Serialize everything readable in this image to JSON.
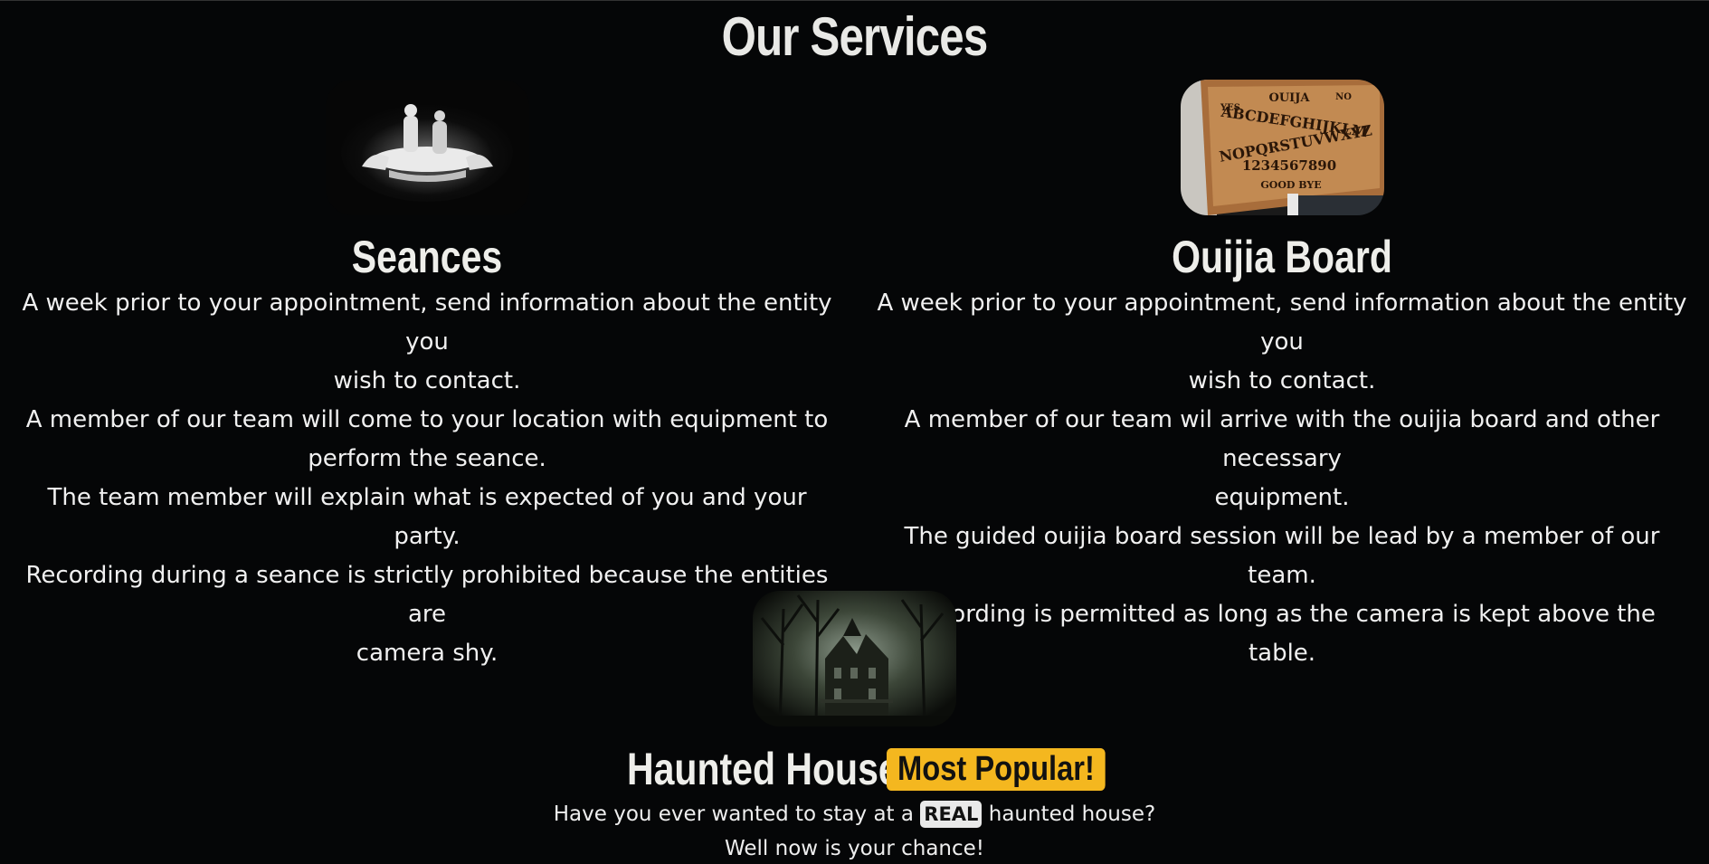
{
  "page": {
    "title": "Our Services"
  },
  "services": [
    {
      "title": "Seances",
      "image_icon": "seance-photo",
      "lines": [
        "A week prior to your appointment, send information about the entity you",
        "wish to contact.",
        "A member of our team will come to your location with equipment to",
        "perform the seance.",
        "The team member will explain what is expected of you and your party.",
        "Recording during a seance is strictly prohibited because the entities are",
        "camera shy."
      ]
    },
    {
      "title": "Ouijia Board",
      "image_icon": "ouija-board-photo",
      "board_text": {
        "yes": "YES",
        "word": "OUIJA",
        "no": "NO",
        "row1": "ABCDEFGHIJKLM",
        "row2": "NOPQRSTUVWXYZ",
        "numbers": "1234567890",
        "bye": "GOOD BYE"
      },
      "lines": [
        "A week prior to your appointment, send information about the entity you",
        "wish to contact.",
        "A member of our team wil arrive with the ouijia board and other necessary",
        "equipment.",
        "The guided ouijia board session will be lead by a member of our team.",
        "Recording is permitted as long as the camera is kept above the table."
      ]
    }
  ],
  "haunted_house": {
    "title": "Haunted House",
    "badge": "Most Popular!",
    "image_icon": "haunted-house-photo",
    "line1_before": "Have you ever wanted to stay at a",
    "line1_highlight": "REAL",
    "line1_after": "haunted house?",
    "line2": "Well now is your chance!"
  },
  "colors": {
    "background": "#050607",
    "badge": "#f4b71f",
    "text": "#eeeeee"
  }
}
